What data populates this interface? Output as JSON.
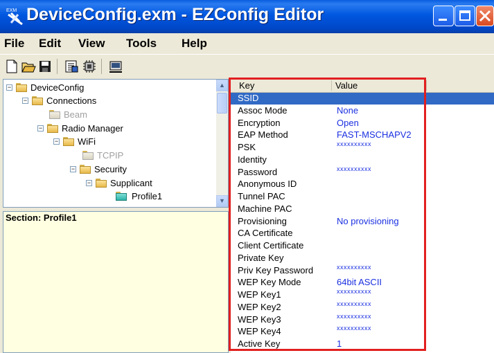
{
  "window": {
    "title": "DeviceConfig.exm - EZConfig Editor",
    "app_icon_label": "EXM",
    "controls": [
      "minimize",
      "maximize",
      "close"
    ]
  },
  "menu": [
    {
      "label": "File"
    },
    {
      "label": "Edit"
    },
    {
      "label": "View"
    },
    {
      "label": "Tools"
    },
    {
      "label": "Help"
    }
  ],
  "toolbar": {
    "buttons": [
      "new-icon",
      "open-folder-icon",
      "save-icon",
      "properties-icon",
      "chip-icon",
      "device-icon"
    ]
  },
  "tree": {
    "nodes": [
      {
        "label": "DeviceConfig",
        "expander": "−",
        "state": "normal"
      },
      {
        "label": "Connections",
        "expander": "−",
        "state": "normal"
      },
      {
        "label": "Beam",
        "expander": "",
        "state": "disabled"
      },
      {
        "label": "Radio Manager",
        "expander": "−",
        "state": "normal"
      },
      {
        "label": "WiFi",
        "expander": "−",
        "state": "normal"
      },
      {
        "label": "TCPIP",
        "expander": "",
        "state": "disabled"
      },
      {
        "label": "Security",
        "expander": "−",
        "state": "normal"
      },
      {
        "label": "Supplicant",
        "expander": "−",
        "state": "normal"
      },
      {
        "label": "Profile1",
        "expander": "",
        "state": "selected"
      }
    ]
  },
  "section": {
    "label": "Section: Profile1"
  },
  "grid": {
    "columns": [
      "Key",
      "Value"
    ],
    "rows": [
      {
        "key": "SSID",
        "value": "",
        "selected": true
      },
      {
        "key": "Assoc Mode",
        "value": "None"
      },
      {
        "key": "Encryption",
        "value": "Open"
      },
      {
        "key": "EAP Method",
        "value": "FAST-MSCHAPV2"
      },
      {
        "key": "PSK",
        "value": "xxxxxxxxxx",
        "masked": true
      },
      {
        "key": "Identity",
        "value": ""
      },
      {
        "key": "Password",
        "value": "xxxxxxxxxx",
        "masked": true
      },
      {
        "key": "Anonymous ID",
        "value": ""
      },
      {
        "key": "Tunnel PAC",
        "value": ""
      },
      {
        "key": "Machine PAC",
        "value": ""
      },
      {
        "key": "Provisioning",
        "value": "No provisioning"
      },
      {
        "key": "CA Certificate",
        "value": ""
      },
      {
        "key": "Client Certificate",
        "value": ""
      },
      {
        "key": "Private Key",
        "value": ""
      },
      {
        "key": "Priv Key Password",
        "value": "xxxxxxxxxx",
        "masked": true
      },
      {
        "key": "WEP Key Mode",
        "value": "64bit ASCII"
      },
      {
        "key": "WEP Key1",
        "value": "xxxxxxxxxx",
        "masked": true
      },
      {
        "key": "WEP Key2",
        "value": "xxxxxxxxxx",
        "masked": true
      },
      {
        "key": "WEP Key3",
        "value": "xxxxxxxxxx",
        "masked": true
      },
      {
        "key": "WEP Key4",
        "value": "xxxxxxxxxx",
        "masked": true
      },
      {
        "key": "Active Key",
        "value": "1"
      }
    ]
  },
  "colors": {
    "highlight_box": "#e21f1f",
    "selected_row": "#316ac5",
    "value_text": "#1a2fe0"
  }
}
